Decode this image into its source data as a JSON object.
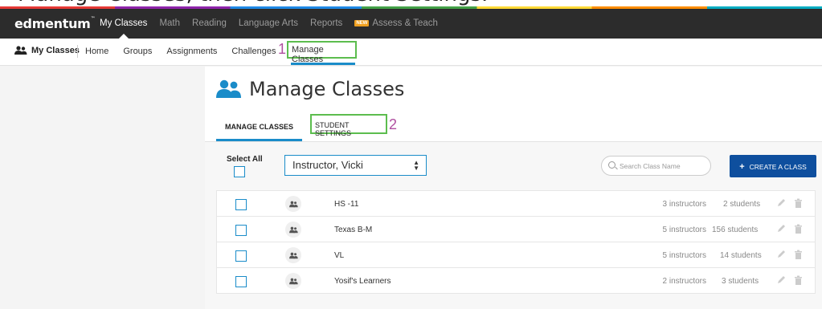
{
  "banner": {
    "text": "Manage Classes, then click Student Settings."
  },
  "topnav": {
    "logo": "edmentum",
    "logo_tm": "™",
    "items": [
      {
        "label": "My Classes",
        "active": true
      },
      {
        "label": "Math",
        "active": false
      },
      {
        "label": "Reading",
        "active": false
      },
      {
        "label": "Language Arts",
        "active": false
      },
      {
        "label": "Reports",
        "active": false
      },
      {
        "label": "Assess & Teach",
        "active": false,
        "badge": "NEW"
      }
    ]
  },
  "subnav": {
    "title": "My Classes",
    "items": [
      "Home",
      "Groups",
      "Assignments",
      "Challenges"
    ],
    "callout1": "1",
    "active": "Manage Classes"
  },
  "main": {
    "title": "Manage Classes",
    "tab_manage": "MANAGE CLASSES",
    "tab_student": "STUDENT SETTINGS",
    "callout2": "2",
    "select_all": "Select All",
    "instructor_select": "Instructor, Vicki",
    "search_placeholder": "Search Class Name",
    "create_button": "CREATE A CLASS",
    "create_plus": "+"
  },
  "classes": [
    {
      "name": "HS -11",
      "instructors": "3 instructors",
      "students": "2 students"
    },
    {
      "name": "Texas B-M",
      "instructors": "5 instructors",
      "students": "156 students"
    },
    {
      "name": "VL",
      "instructors": "5 instructors",
      "students": "14 students"
    },
    {
      "name": "Yosif's Learners",
      "instructors": "2 instructors",
      "students": "3 students"
    }
  ],
  "colors": {
    "accent": "#1a8cc9",
    "button": "#0e4f9e",
    "callout_box": "#5cbd4e",
    "callout_number": "#b04fa0",
    "navbar": "#2c2c2c"
  }
}
